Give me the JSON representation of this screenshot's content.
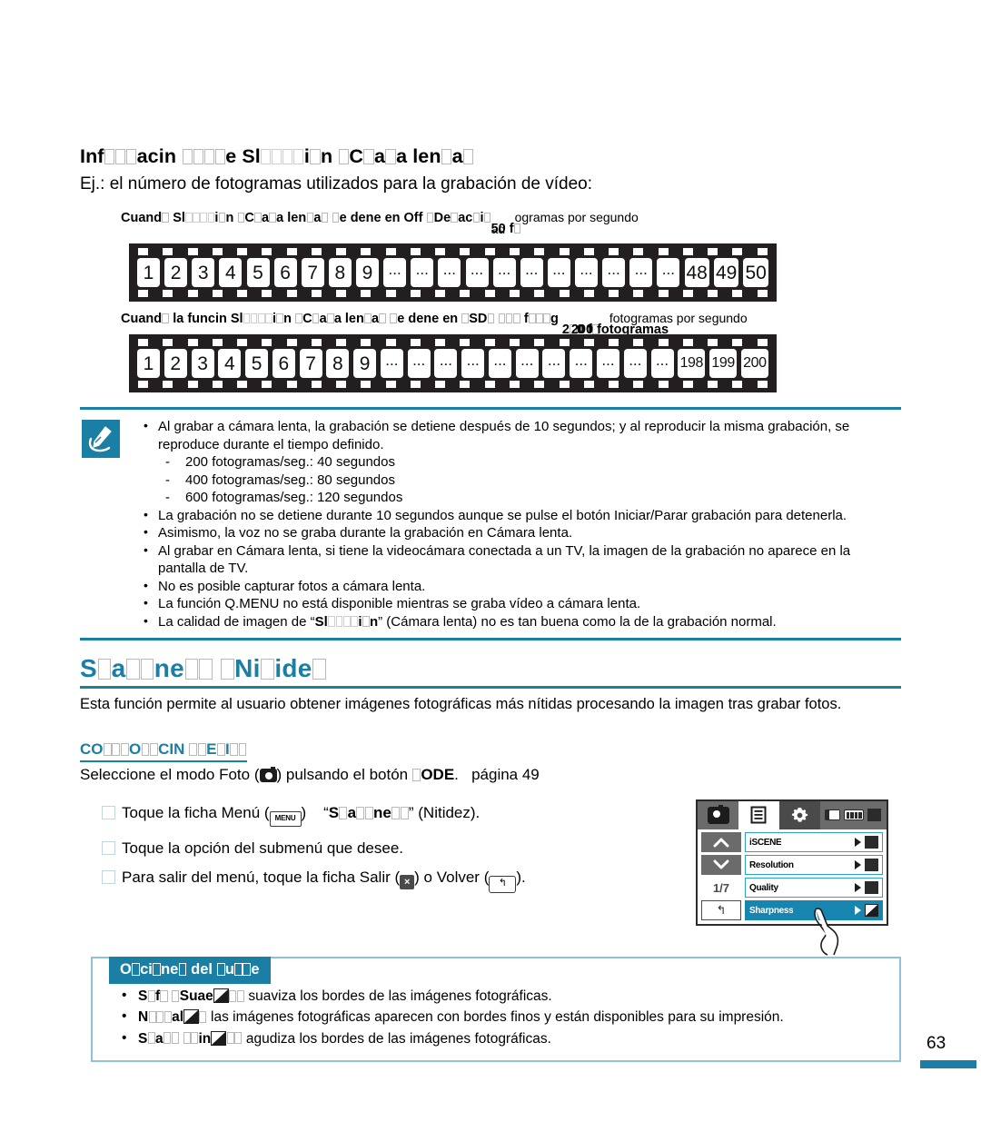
{
  "section": {
    "title_prefix": "Inf",
    "title_parts": [
      "Inf",
      "acin",
      "e Sl",
      "i",
      "n ",
      "C",
      "a",
      "a len",
      "a"
    ],
    "title_text": "Información sobre Slow motion (Cámara lenta)",
    "subtitle": "Ej.: el número de fotogramas utilizados para la grabación de vídeo:"
  },
  "strip1": {
    "caption_bold": "Cuand  Sl     i n  C a a len a   e dene en Off  De  ac i  ",
    "caption_overlap": "50 ",
    "caption_reg": "fotogramas por segundo",
    "frames": [
      "1",
      "2",
      "3",
      "4",
      "5",
      "6",
      "7",
      "8",
      "9",
      "...",
      "...",
      "...",
      "...",
      "...",
      "...",
      "...",
      "...",
      "...",
      "...",
      "...",
      "48",
      "49",
      "50"
    ]
  },
  "strip2": {
    "caption_bold": "Cuand  la funcin Sl     i n  C a a len a   e dene en  SD    f   g  2 0 ",
    "caption_overlap": "200 fotogramas",
    "caption_reg": "fotogramas por segundo",
    "frames": [
      "1",
      "2",
      "3",
      "4",
      "5",
      "6",
      "7",
      "8",
      "9",
      "...",
      "...",
      "...",
      "...",
      "...",
      "...",
      "...",
      "...",
      "...",
      "...",
      "...",
      "198",
      "199",
      "200"
    ]
  },
  "note": {
    "icon": "note-hand-icon",
    "accent": "#1a7ea5",
    "bullets": [
      "Al grabar a cámara lenta, la grabación se detiene después de 10 segundos; y al reproducir la misma grabación, se reproduce durante el tiempo definido.",
      "La grabación no se detiene durante 10 segundos aunque se pulse el botón Iniciar/Parar grabación para detenerla.",
      "Asimismo, la voz no se graba durante la grabación en Cámara lenta.",
      "Al grabar en Cámara lenta, si tiene la videocámara conectada a un TV, la imagen de la grabación no aparece en la pantalla de TV.",
      "No es posible capturar fotos a cámara lenta.",
      "La función Q.MENU no está disponible mientras se graba vídeo a cámara lenta."
    ],
    "sub_bullets": [
      "200 fotogramas/seg.: 40 segundos",
      "400 fotogramas/seg.: 80 segundos",
      "600 fotogramas/seg.: 120 segundos"
    ],
    "last_bullet_prefix": "La calidad de imagen de “",
    "last_bullet_bold": "Sl     i n",
    "last_bullet_suffix": "” (Cámara lenta) no es tan buena como la de la grabación normal."
  },
  "sharpness": {
    "heading_text": "Sharpness (Nitidez)",
    "heading_parts": [
      "S",
      "a",
      "ne",
      " ",
      "Ni",
      "ide",
      ""
    ],
    "paragraph": "Esta función permite al usuario obtener imágenes fotográficas más nítidas procesando la imagen tras grabar fotos.",
    "sub_heading_text": "CONFIGURACIÓN DEL ELEMENTO",
    "mode_line_prefix": "Seleccione el modo Foto (",
    "mode_line_middle": ") pulsando el botón ",
    "mode_line_bold": "ODE",
    "mode_line_suffix": ".",
    "mode_line_page": "página 49"
  },
  "steps": [
    {
      "num": "1",
      "pre": "Toque la ficha Menú (",
      "icon": "menu-icon",
      "icon_label": "MENU",
      "mid": ")",
      "quoted": "S a  ne",
      "post": "(Nitidez)."
    },
    {
      "num": "2",
      "text": "Toque la opción del submenú que desee."
    },
    {
      "num": "3",
      "pre": "Para salir del menú, toque la ficha Salir (",
      "exit_icon": "×",
      "mid": ") o Volver (",
      "back_icon": "↰",
      "post": ")."
    }
  ],
  "lcd": {
    "tabs": [
      "camera-tab",
      "menu-tab",
      "settings-tab"
    ],
    "page_indicator": "1/7",
    "back_icon": "↰",
    "up_icon": "▲",
    "down_icon": "▼",
    "menu_items": [
      {
        "label": "iSCENE",
        "icon": "iscene-icon",
        "selected": false
      },
      {
        "label": "Resolution",
        "icon": "resolution-icon",
        "selected": false
      },
      {
        "label": "Quality",
        "icon": "quality-icon",
        "selected": false
      },
      {
        "label": "Sharpness",
        "icon": "sharpness-icon",
        "selected": true
      }
    ]
  },
  "options": {
    "badge": "Opciones del submenu",
    "badge_parts": [
      "O",
      "ci",
      "ne",
      " del ",
      "u",
      "e"
    ],
    "items": [
      {
        "bold": "S f   Suae",
        "icon": "soft-icon",
        "text": "suaviza los bordes de las imágenes fotográficas."
      },
      {
        "bold": "N   al",
        "icon": "normal-icon",
        "text": "las imágenes fotográficas aparecen con bordes finos y están disponibles para su impresión."
      },
      {
        "bold": "S a    in",
        "icon": "sharp-icon",
        "text": "agudiza los bordes de las imágenes fotográficas."
      }
    ]
  },
  "footer": {
    "page_number": "63"
  },
  "colors": {
    "accent": "#1a7ea5",
    "accent_light": "#8fc2d8",
    "film": "#231f20",
    "lcd_select": "#1686b0"
  }
}
